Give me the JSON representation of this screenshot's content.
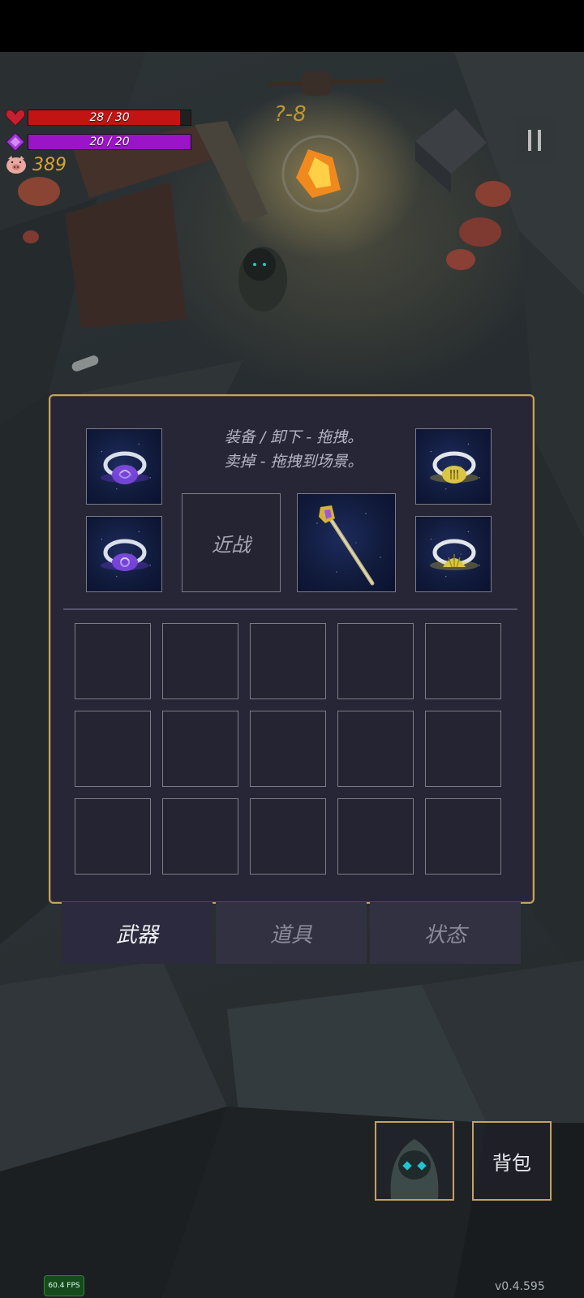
{
  "hud": {
    "hp": {
      "current": 28,
      "max": 30,
      "text": "28 / 30",
      "fraction": 0.933,
      "icon": "heart-icon",
      "color": "#c31414"
    },
    "mp": {
      "current": 20,
      "max": 20,
      "text": "20 / 20",
      "fraction": 1.0,
      "icon": "diamond-icon",
      "color": "#9b14c8"
    },
    "gold": {
      "value": "389",
      "icon": "pig-icon",
      "color": "#d8a52e"
    },
    "floating_text": "?-8",
    "pause_icon": "pause-icon"
  },
  "inventory": {
    "hint_line1": "装备 / 卸下 - 拖拽。",
    "hint_line2": "卖掉 - 拖拽到场景。",
    "melee_label": "近战",
    "equipped": [
      {
        "slot": "ring-top-left",
        "icon": "purple-gem-ring-icon"
      },
      {
        "slot": "ring-bottom-left",
        "icon": "purple-swirl-ring-icon"
      },
      {
        "slot": "weapon",
        "icon": "golden-staff-icon"
      },
      {
        "slot": "ring-top-right",
        "icon": "gold-gem-ring-icon"
      },
      {
        "slot": "ring-bottom-right",
        "icon": "gold-shell-ring-icon"
      }
    ],
    "grid_rows": 3,
    "grid_cols": 5,
    "border_color": "#c7a160"
  },
  "tabs": [
    {
      "label": "武器",
      "active": true
    },
    {
      "label": "道具",
      "active": false
    },
    {
      "label": "状态",
      "active": false
    }
  ],
  "bottom": {
    "character_icon": "hooded-character-icon",
    "bag_label": "背包",
    "fps": "60.4 FPS",
    "version": "v0.4.595"
  }
}
